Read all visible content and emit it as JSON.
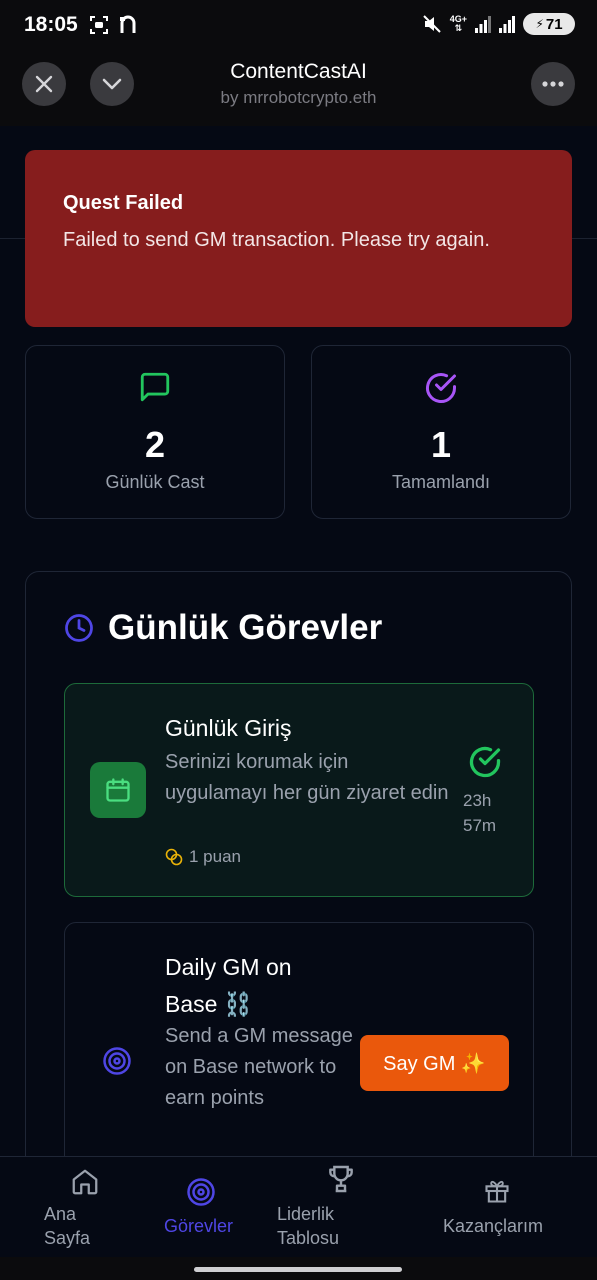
{
  "status_bar": {
    "time": "18:05",
    "network": "4G+",
    "battery": "71"
  },
  "app": {
    "title": "ContentCastAI",
    "subtitle": "by mrrobotcrypto.eth"
  },
  "toast": {
    "title": "Quest Failed",
    "message": "Failed to send GM transaction. Please try again."
  },
  "stats": [
    {
      "value": "2",
      "label": "Günlük Cast",
      "icon": "message-icon",
      "color": "#22c55e"
    },
    {
      "value": "1",
      "label": "Tamamlandı",
      "icon": "check-circle-icon",
      "color": "#a855f7"
    }
  ],
  "tasks_section": {
    "title": "Günlük Görevler",
    "items": [
      {
        "title": "Günlük Giriş",
        "description": "Serinizi korumak için uygulamayı her gün ziyaret edin",
        "points": "1 puan",
        "time_left": "23h 57m",
        "status": "completed"
      },
      {
        "title": "Daily GM on Base ⛓️",
        "description": "Send a GM message on Base network to earn points",
        "button": "Say GM ✨"
      }
    ]
  },
  "bottom_nav": {
    "items": [
      {
        "label": "Ana Sayfa",
        "active": false
      },
      {
        "label": "Görevler",
        "active": true
      },
      {
        "label": "Liderlik Tablosu",
        "active": false
      },
      {
        "label": "Kazançlarım",
        "active": false
      }
    ]
  },
  "colors": {
    "background": "#050914",
    "toast_bg": "#861d1d",
    "accent": "#4f46e5",
    "cta": "#ea580c",
    "success": "#22c55e"
  }
}
